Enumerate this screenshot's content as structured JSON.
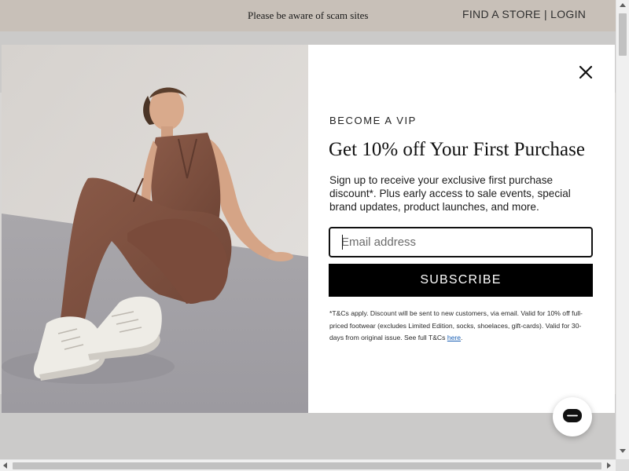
{
  "announcement": {
    "text": "Please be aware of scam sites"
  },
  "header_links": {
    "find_store": "FIND A STORE",
    "separator": "|",
    "login": "LOGIN"
  },
  "modal": {
    "image_alt": "Model in brown vest and wide-leg trousers wearing white sneakers",
    "eyebrow": "BECOME A VIP",
    "headline": "Get 10% off Your First Purchase",
    "description": "Sign up to receive your exclusive first purchase discount*. Plus early access to sale events, special brand updates, product launches, and more.",
    "email": {
      "value": "",
      "placeholder": "Email address"
    },
    "subscribe_label": "SUBSCRIBE",
    "terms_text": "*T&Cs apply. Discount will be sent to new customers, via email. Valid for 10% off full-priced footwear (excludes Limited Edition, socks, shoelaces, gift-cards). Valid for 30-days from original issue. See full T&Cs ",
    "terms_link": "here",
    "terms_end": ".",
    "close_icon": "close-icon"
  },
  "chat": {
    "icon": "chat-icon"
  },
  "colors": {
    "announcement_bg": "#c8c0b8",
    "button_bg": "#000000",
    "link": "#1a5fb4"
  }
}
